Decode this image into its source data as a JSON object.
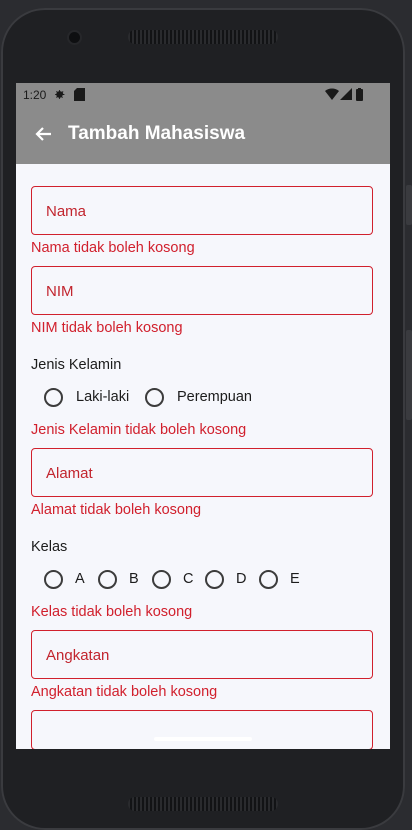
{
  "status": {
    "time": "1:20"
  },
  "appbar": {
    "title": "Tambah Mahasiswa"
  },
  "form": {
    "nama": {
      "placeholder": "Nama",
      "error": "Nama tidak boleh kosong"
    },
    "nim": {
      "placeholder": "NIM",
      "error": "NIM tidak boleh kosong"
    },
    "jenis_kelamin": {
      "label": "Jenis Kelamin",
      "options": [
        "Laki-laki",
        "Perempuan"
      ],
      "error": "Jenis Kelamin tidak boleh kosong"
    },
    "alamat": {
      "placeholder": "Alamat",
      "error": "Alamat tidak boleh kosong"
    },
    "kelas": {
      "label": "Kelas",
      "options": [
        "A",
        "B",
        "C",
        "D",
        "E"
      ],
      "error": "Kelas tidak boleh kosong"
    },
    "angkatan": {
      "placeholder": "Angkatan",
      "error": "Angkatan tidak boleh kosong"
    }
  },
  "colors": {
    "error": "#d1202d",
    "appbar": "#8b8b8b",
    "background": "#f6f7fc"
  },
  "icons": [
    "settings-icon",
    "sd-card-icon",
    "wifi-icon",
    "signal-icon",
    "battery-icon",
    "back-arrow-icon"
  ]
}
